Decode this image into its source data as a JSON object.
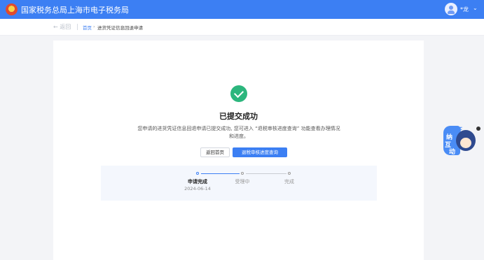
{
  "header": {
    "app_title": "国家税务总局上海市电子税务局",
    "user_name": "*龙",
    "user_caret": "⌄"
  },
  "breadcrumb": {
    "back_label": "← 返回",
    "home_label": "首页",
    "separator": "›",
    "current_label": "进货凭证信息回退申请"
  },
  "result": {
    "title": "已提交成功",
    "description": "您申请的进货凭证信息回退申请已提交成功, 您可进入 “退税审核进度查询” 功能查看办理情况和进度。"
  },
  "actions": {
    "home_button": "返回首页",
    "progress_button": "退税审核进度查询"
  },
  "steps": [
    {
      "label": "申请完成",
      "date": "2024-06-14",
      "status": "done"
    },
    {
      "label": "受理中",
      "date": "",
      "status": "pending"
    },
    {
      "label": "完成",
      "date": "",
      "status": "pending"
    }
  ],
  "mascot": {
    "chars": [
      "纳",
      "互",
      "动",
      "证"
    ]
  },
  "colors": {
    "accent": "#3c7ff3",
    "success": "#2cb67d",
    "steps_bg": "#f4f7fd"
  },
  "icons": [
    "tax-emblem-icon",
    "user-avatar-icon",
    "chevron-down-icon",
    "success-check-icon",
    "mascot-icon"
  ]
}
